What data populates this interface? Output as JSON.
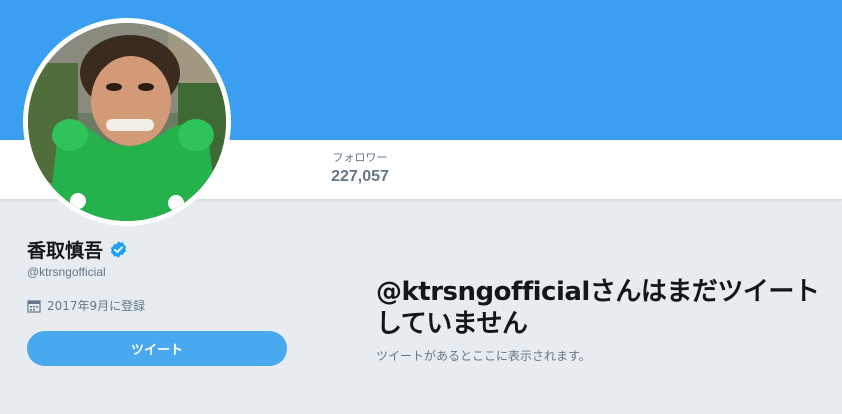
{
  "profile": {
    "display_name": "香取慎吾",
    "handle": "@ktrsngofficial",
    "joined": "2017年9月に登録",
    "verified": true
  },
  "stats": {
    "followers_label": "フォロワー",
    "followers_value": "227,057"
  },
  "actions": {
    "tweet_button_label": "ツイート"
  },
  "empty_state": {
    "title": "@ktrsngofficialさんはまだツイートしていません",
    "subtitle": "ツイートがあるとここに表示されます。"
  },
  "colors": {
    "banner": "#3a9ff1",
    "page_background": "#e6ecf0",
    "accent": "#4aa8ee",
    "verified_badge": "#1da1f2",
    "muted_text": "#657786"
  },
  "icons": {
    "verified": "verified-badge-icon",
    "calendar": "calendar-icon"
  }
}
